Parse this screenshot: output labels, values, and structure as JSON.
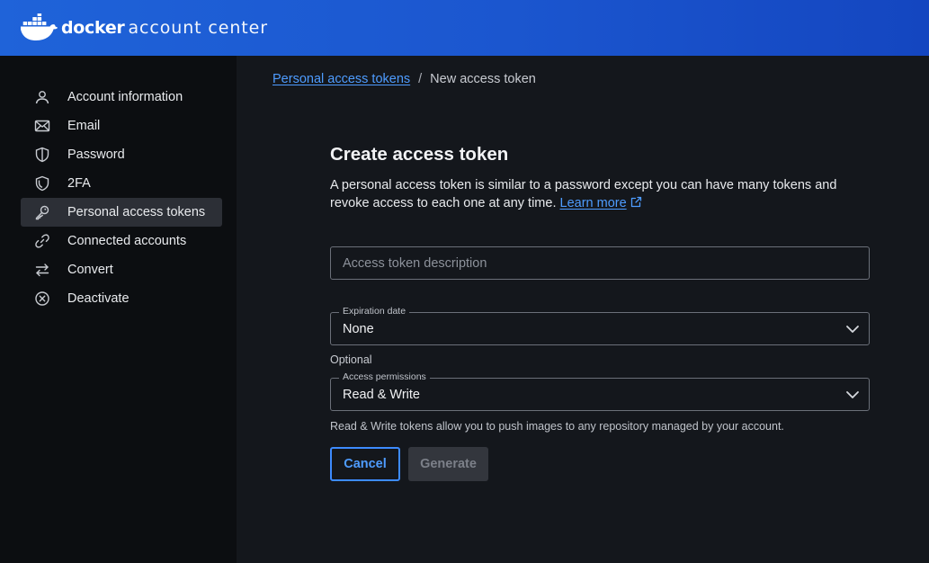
{
  "header": {
    "brand": "docker",
    "product": "account center",
    "logo_icon": "docker-whale-icon",
    "bg_color": "#1b56cf"
  },
  "sidebar": {
    "items": [
      {
        "label": "Account information",
        "icon": "person-icon",
        "active": false
      },
      {
        "label": "Email",
        "icon": "mail-icon",
        "active": false
      },
      {
        "label": "Password",
        "icon": "shield-icon",
        "active": false
      },
      {
        "label": "2FA",
        "icon": "shield-check-icon",
        "active": false
      },
      {
        "label": "Personal access tokens",
        "icon": "key-icon",
        "active": true
      },
      {
        "label": "Connected accounts",
        "icon": "link-icon",
        "active": false
      },
      {
        "label": "Convert",
        "icon": "swap-arrows-icon",
        "active": false
      },
      {
        "label": "Deactivate",
        "icon": "x-circle-icon",
        "active": false
      }
    ]
  },
  "breadcrumb": {
    "parent": "Personal access tokens",
    "separator": "/",
    "current": "New access token"
  },
  "form": {
    "title": "Create access token",
    "description": "A personal access token is similar to a password except you can have many tokens and revoke access to each one at any time.",
    "learn_more": "Learn more",
    "description_input": {
      "placeholder": "Access token description",
      "value": ""
    },
    "expiration": {
      "label": "Expiration date",
      "value": "None"
    },
    "optional_label": "Optional",
    "permissions": {
      "label": "Access permissions",
      "value": "Read & Write"
    },
    "hint": "Read & Write tokens allow you to push images to any repository managed by your account.",
    "cancel_label": "Cancel",
    "generate_label": "Generate"
  },
  "colors": {
    "accent": "#4e9cff",
    "sidebar_bg": "#0c0e11",
    "main_bg": "#14171c",
    "active_item_bg": "#2c2f36"
  }
}
